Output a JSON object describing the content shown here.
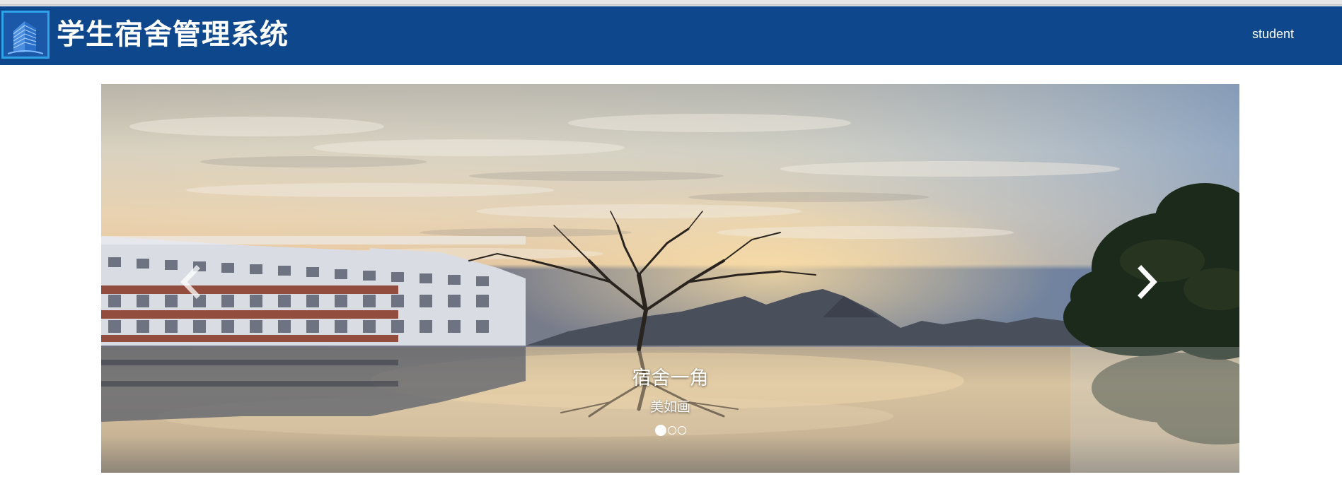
{
  "header": {
    "app_title": "学生宿舍管理系统",
    "user_label": "student",
    "logo_icon": "building-icon",
    "background_color": "#0f478c",
    "logo_border_color": "#2ea3ea"
  },
  "carousel": {
    "slide_title": "宿舍一角",
    "slide_subtitle": "美如画",
    "prev_icon": "chevron-left-icon",
    "next_icon": "chevron-right-icon",
    "indicator_count": 3,
    "active_index": 0
  }
}
